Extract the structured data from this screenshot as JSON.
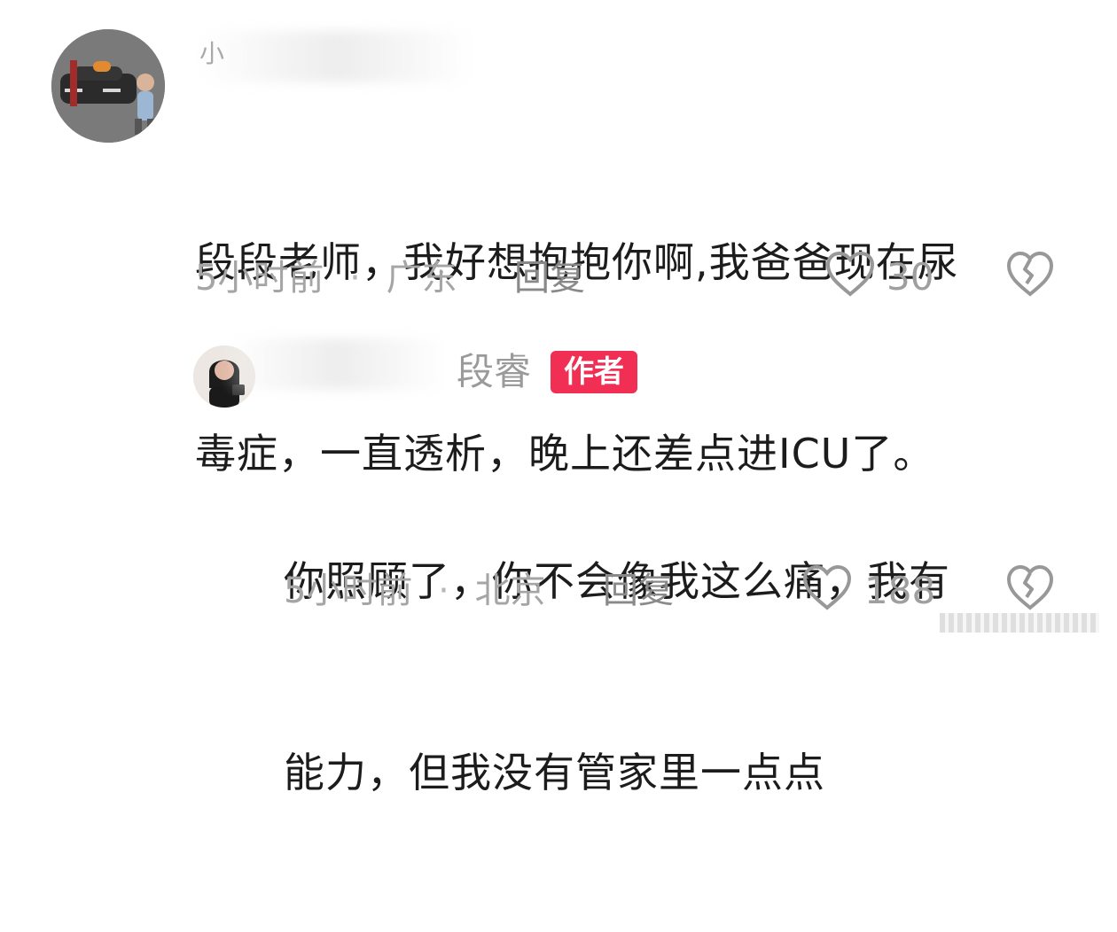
{
  "comments": [
    {
      "user": {
        "name_visible_fragment": "小",
        "avatar_label": "avatar"
      },
      "text_line1": "段段老师，我好想抱抱你啊,我爸爸现在尿",
      "text_line2": "毒症，一直透析，晚上还差点进ICU了。",
      "meta": {
        "time": "5小时前",
        "location": "广东",
        "dot": "·"
      },
      "actions": {
        "reply_label": "回复",
        "like_count": "30"
      }
    },
    {
      "user": {
        "name": "段睿",
        "badge": "作者",
        "avatar_label": "avatar"
      },
      "text_line1": "你照顾了，你不会像我这么痛，我有",
      "text_line2": "能力，但我没有管家里一点点",
      "meta": {
        "time": "5小时前",
        "location": "北京",
        "dot": "·"
      },
      "actions": {
        "reply_label": "回复",
        "like_count": "188"
      }
    }
  ],
  "icons": {
    "like": "heart-icon",
    "dislike": "broken-heart-icon"
  },
  "colors": {
    "text_primary": "#1f1f1f",
    "meta_gray": "#a5a5a5",
    "author_badge": "#f12e53",
    "background": "#ffffff"
  }
}
